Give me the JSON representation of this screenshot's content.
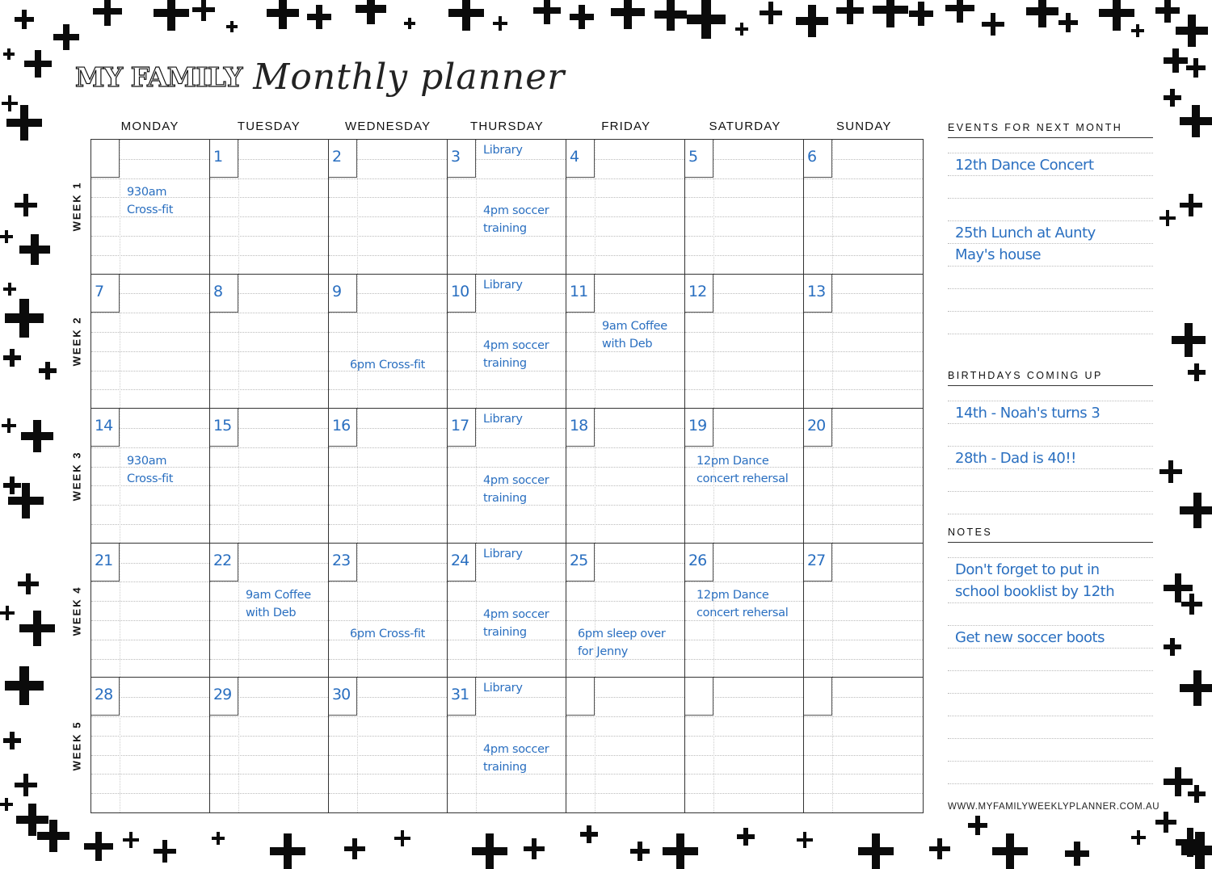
{
  "header": {
    "title_main": "MY FAMILY",
    "title_script": "Monthly planner"
  },
  "days": [
    "MONDAY",
    "TUESDAY",
    "WEDNESDAY",
    "THURSDAY",
    "FRIDAY",
    "SATURDAY",
    "SUNDAY"
  ],
  "weeks": [
    "WEEK 1",
    "WEEK 2",
    "WEEK 3",
    "WEEK 4",
    "WEEK 5"
  ],
  "cells": [
    {
      "num": "",
      "notes": [
        {
          "text": "930am\nCross-fit",
          "row": 2
        }
      ]
    },
    {
      "num": "1",
      "notes": []
    },
    {
      "num": "2",
      "notes": []
    },
    {
      "num": "3",
      "notes": [
        {
          "text": "Library",
          "row": 0
        },
        {
          "text": "4pm soccer\ntraining",
          "row": 3
        }
      ]
    },
    {
      "num": "4",
      "notes": []
    },
    {
      "num": "5",
      "notes": []
    },
    {
      "num": "6",
      "notes": []
    },
    {
      "num": "7",
      "notes": []
    },
    {
      "num": "8",
      "notes": []
    },
    {
      "num": "9",
      "notes": [
        {
          "text": "6pm Cross-fit",
          "row": 4,
          "indent": true
        }
      ]
    },
    {
      "num": "10",
      "notes": [
        {
          "text": "Library",
          "row": 0
        },
        {
          "text": "4pm soccer\ntraining",
          "row": 3
        }
      ]
    },
    {
      "num": "11",
      "notes": [
        {
          "text": "9am Coffee\nwith Deb",
          "row": 2
        }
      ]
    },
    {
      "num": "12",
      "notes": []
    },
    {
      "num": "13",
      "notes": []
    },
    {
      "num": "14",
      "notes": [
        {
          "text": "930am\nCross-fit",
          "row": 2
        }
      ]
    },
    {
      "num": "15",
      "notes": []
    },
    {
      "num": "16",
      "notes": []
    },
    {
      "num": "17",
      "notes": [
        {
          "text": "Library",
          "row": 0
        },
        {
          "text": "4pm soccer\ntraining",
          "row": 3
        }
      ]
    },
    {
      "num": "18",
      "notes": []
    },
    {
      "num": "19",
      "notes": [
        {
          "text": "12pm Dance\nconcert rehersal",
          "row": 2,
          "left": true
        }
      ]
    },
    {
      "num": "20",
      "notes": []
    },
    {
      "num": "21",
      "notes": []
    },
    {
      "num": "22",
      "notes": [
        {
          "text": "9am Coffee\nwith Deb",
          "row": 2
        }
      ]
    },
    {
      "num": "23",
      "notes": [
        {
          "text": "6pm Cross-fit",
          "row": 4,
          "indent": true
        }
      ]
    },
    {
      "num": "24",
      "notes": [
        {
          "text": "Library",
          "row": 0
        },
        {
          "text": "4pm soccer\ntraining",
          "row": 3
        }
      ]
    },
    {
      "num": "25",
      "notes": [
        {
          "text": "6pm sleep over\nfor Jenny",
          "row": 4,
          "left": true
        }
      ]
    },
    {
      "num": "26",
      "notes": [
        {
          "text": "12pm Dance\nconcert rehersal",
          "row": 2,
          "left": true
        }
      ]
    },
    {
      "num": "27",
      "notes": []
    },
    {
      "num": "28",
      "notes": []
    },
    {
      "num": "29",
      "notes": []
    },
    {
      "num": "30",
      "notes": []
    },
    {
      "num": "31",
      "notes": [
        {
          "text": "Library",
          "row": 0
        },
        {
          "text": "4pm soccer\ntraining",
          "row": 3
        }
      ]
    },
    {
      "num": "",
      "notes": []
    },
    {
      "num": "",
      "notes": []
    },
    {
      "num": "",
      "notes": []
    }
  ],
  "sidebar": {
    "events": {
      "title": "EVENTS FOR NEXT MONTH",
      "entries": [
        "12th Dance Concert",
        "25th Lunch at Aunty\nMay's house"
      ]
    },
    "birthdays": {
      "title": "BIRTHDAYS COMING UP",
      "entries": [
        "14th - Noah's turns 3",
        "28th - Dad is 40!!"
      ]
    },
    "notes": {
      "title": "NOTES",
      "entries": [
        "Don't forget to put in\nschool booklist by 12th",
        "Get new soccer boots"
      ]
    }
  },
  "footer": {
    "website": "WWW.MYFAMILYWEEKLYPLANNER.COM.AU"
  },
  "colors": {
    "ink_blue": "#2a6fc0",
    "line": "#333333",
    "cross": "#0b0b0b"
  }
}
